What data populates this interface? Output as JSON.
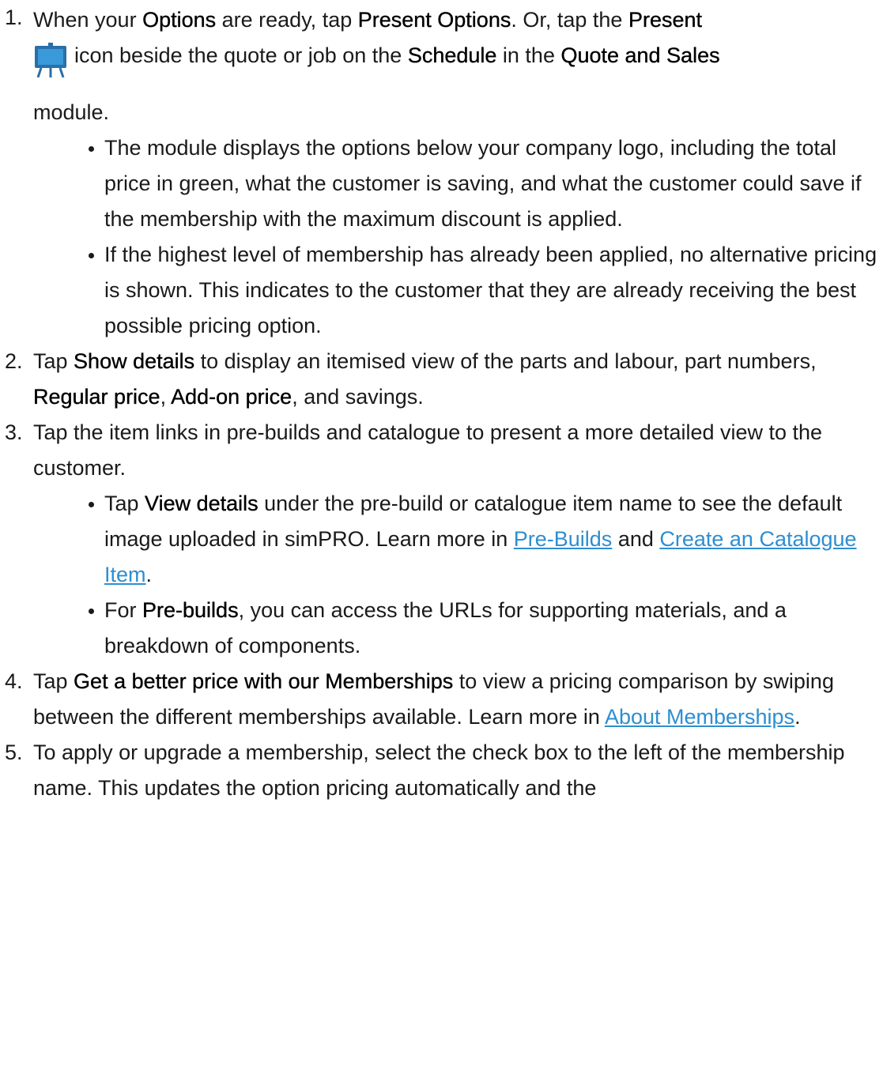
{
  "steps": [
    {
      "number": "1.",
      "parts": [
        {
          "t": "When your "
        },
        {
          "t": "Options",
          "b": true
        },
        {
          "t": " are ready, tap "
        },
        {
          "t": "Present Options",
          "b": true
        },
        {
          "t": ". Or, tap the "
        },
        {
          "t": "Present",
          "b": true
        }
      ],
      "icon": "presentation-board-icon",
      "parts_after_icon": [
        {
          "t": "icon beside the quote or job on the "
        },
        {
          "t": "Schedule",
          "b": true
        },
        {
          "t": " in the "
        },
        {
          "t": "Quote and Sales",
          "b": true
        }
      ],
      "parts_end": [
        {
          "t": "module."
        }
      ],
      "bullets": [
        [
          {
            "t": "The module displays the options below your company logo, including the total price in green, what the customer is saving, and what the customer could save if the membership with the maximum discount is applied."
          }
        ],
        [
          {
            "t": "If the highest level of membership has already been applied, no alternative pricing is shown. This indicates to the customer that they are already receiving the best possible pricing option."
          }
        ]
      ]
    },
    {
      "number": "2.",
      "parts": [
        {
          "t": "Tap "
        },
        {
          "t": "Show details",
          "b": true
        },
        {
          "t": " to display an itemised view of the parts and labour, part numbers, "
        },
        {
          "t": "Regular price",
          "b": true
        },
        {
          "t": ", "
        },
        {
          "t": "Add-on price",
          "b": true
        },
        {
          "t": ", and savings."
        }
      ],
      "bullets": []
    },
    {
      "number": "3.",
      "parts": [
        {
          "t": "Tap the item links in pre-builds and catalogue to present a more detailed view to the customer."
        }
      ],
      "bullets": [
        [
          {
            "t": "Tap "
          },
          {
            "t": "View details",
            "b": true
          },
          {
            "t": " under the pre-build or catalogue item name to see the default image uploaded in simPRO. Learn more in "
          },
          {
            "t": "Pre-Builds",
            "link": true
          },
          {
            "t": " and "
          },
          {
            "t": "Create an Catalogue Item",
            "link": true
          },
          {
            "t": "."
          }
        ],
        [
          {
            "t": "For "
          },
          {
            "t": "Pre-builds",
            "b": true
          },
          {
            "t": ", you can access the URLs for supporting materials, and a breakdown of components."
          }
        ]
      ]
    },
    {
      "number": "4.",
      "parts": [
        {
          "t": "Tap "
        },
        {
          "t": "Get a better price with our Memberships",
          "b": true
        },
        {
          "t": " to view a pricing comparison by swiping between the different memberships available. Learn more in "
        },
        {
          "t": "About Memberships",
          "link": true
        },
        {
          "t": "."
        }
      ],
      "bullets": []
    },
    {
      "number": "5.",
      "parts": [
        {
          "t": "To apply or upgrade a membership, select the check box to the left of the membership name. This updates the option pricing automatically and the"
        }
      ],
      "bullets": []
    }
  ],
  "colors": {
    "text": "#1a1a1a",
    "link": "#2d8ed1",
    "icon_board": "#3a9ad9",
    "icon_frame": "#2a6fa8"
  }
}
